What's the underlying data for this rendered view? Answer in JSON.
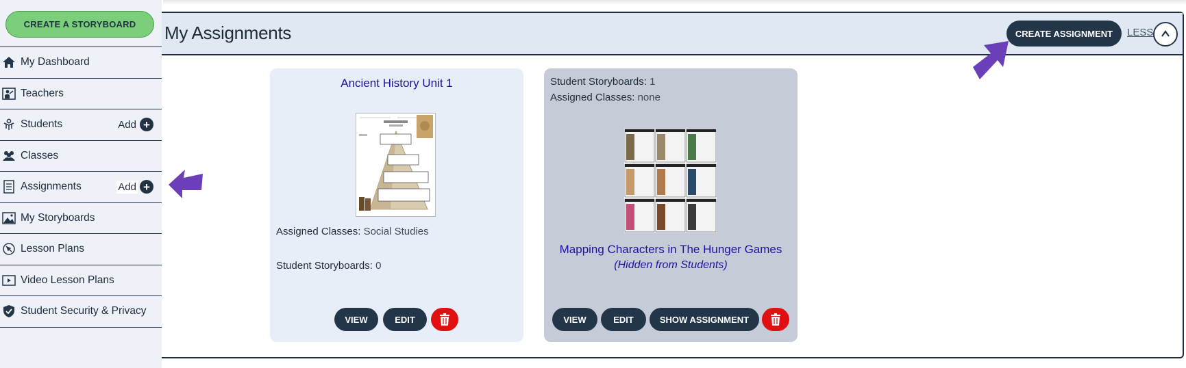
{
  "sidebar": {
    "create_label": "CREATE A STORYBOARD",
    "items": [
      {
        "label": "My Dashboard",
        "icon": "home-icon"
      },
      {
        "label": "Teachers",
        "icon": "teacher-icon"
      },
      {
        "label": "Students",
        "icon": "students-icon",
        "add": "Add"
      },
      {
        "label": "Classes",
        "icon": "classes-icon"
      },
      {
        "label": "Assignments",
        "icon": "assignments-icon",
        "add": "Add"
      },
      {
        "label": "My Storyboards",
        "icon": "image-icon"
      },
      {
        "label": "Lesson Plans",
        "icon": "lesson-plans-icon"
      },
      {
        "label": "Video Lesson Plans",
        "icon": "video-icon"
      },
      {
        "label": "Student Security & Privacy",
        "icon": "shield-icon"
      }
    ]
  },
  "header": {
    "title": "My Assignments",
    "create_label": "CREATE ASSIGNMENT",
    "less_label": "LESS"
  },
  "cards": [
    {
      "title": "Ancient History Unit 1",
      "assigned_classes_label": "Assigned Classes:",
      "assigned_classes_value": "Social Studies",
      "storyboards_label": "Student Storyboards:",
      "storyboards_value": "0",
      "view_label": "VIEW",
      "edit_label": "EDIT"
    },
    {
      "storyboards_label": "Student Storyboards:",
      "storyboards_value": "1",
      "assigned_classes_label": "Assigned Classes:",
      "assigned_classes_value": "none",
      "title": "Mapping Characters in The Hunger Games",
      "hidden_note": "(Hidden from Students)",
      "view_label": "VIEW",
      "edit_label": "EDIT",
      "show_label": "SHOW ASSIGNMENT"
    }
  ],
  "colors": {
    "accent_dark": "#233548",
    "create_green": "#7ccf7a",
    "delete_red": "#e01010",
    "title_blue": "#1a139c",
    "arrow_purple": "#6a3fb8"
  }
}
